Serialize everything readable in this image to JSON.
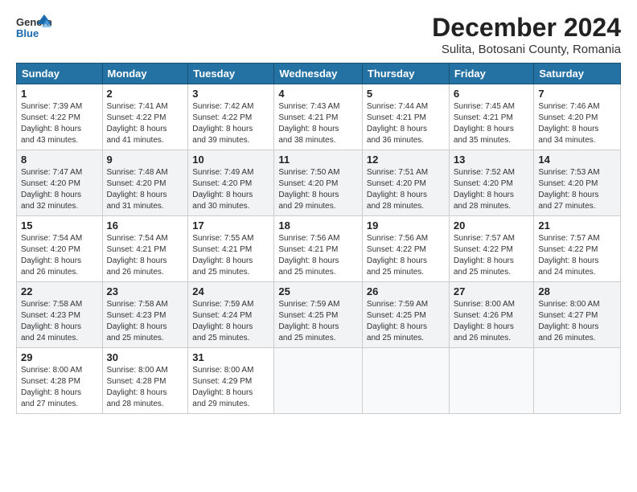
{
  "logo": {
    "line1": "General",
    "line2": "Blue"
  },
  "title": "December 2024",
  "subtitle": "Sulita, Botosani County, Romania",
  "header_days": [
    "Sunday",
    "Monday",
    "Tuesday",
    "Wednesday",
    "Thursday",
    "Friday",
    "Saturday"
  ],
  "weeks": [
    [
      {
        "day": "1",
        "detail": "Sunrise: 7:39 AM\nSunset: 4:22 PM\nDaylight: 8 hours\nand 43 minutes."
      },
      {
        "day": "2",
        "detail": "Sunrise: 7:41 AM\nSunset: 4:22 PM\nDaylight: 8 hours\nand 41 minutes."
      },
      {
        "day": "3",
        "detail": "Sunrise: 7:42 AM\nSunset: 4:22 PM\nDaylight: 8 hours\nand 39 minutes."
      },
      {
        "day": "4",
        "detail": "Sunrise: 7:43 AM\nSunset: 4:21 PM\nDaylight: 8 hours\nand 38 minutes."
      },
      {
        "day": "5",
        "detail": "Sunrise: 7:44 AM\nSunset: 4:21 PM\nDaylight: 8 hours\nand 36 minutes."
      },
      {
        "day": "6",
        "detail": "Sunrise: 7:45 AM\nSunset: 4:21 PM\nDaylight: 8 hours\nand 35 minutes."
      },
      {
        "day": "7",
        "detail": "Sunrise: 7:46 AM\nSunset: 4:20 PM\nDaylight: 8 hours\nand 34 minutes."
      }
    ],
    [
      {
        "day": "8",
        "detail": "Sunrise: 7:47 AM\nSunset: 4:20 PM\nDaylight: 8 hours\nand 32 minutes."
      },
      {
        "day": "9",
        "detail": "Sunrise: 7:48 AM\nSunset: 4:20 PM\nDaylight: 8 hours\nand 31 minutes."
      },
      {
        "day": "10",
        "detail": "Sunrise: 7:49 AM\nSunset: 4:20 PM\nDaylight: 8 hours\nand 30 minutes."
      },
      {
        "day": "11",
        "detail": "Sunrise: 7:50 AM\nSunset: 4:20 PM\nDaylight: 8 hours\nand 29 minutes."
      },
      {
        "day": "12",
        "detail": "Sunrise: 7:51 AM\nSunset: 4:20 PM\nDaylight: 8 hours\nand 28 minutes."
      },
      {
        "day": "13",
        "detail": "Sunrise: 7:52 AM\nSunset: 4:20 PM\nDaylight: 8 hours\nand 28 minutes."
      },
      {
        "day": "14",
        "detail": "Sunrise: 7:53 AM\nSunset: 4:20 PM\nDaylight: 8 hours\nand 27 minutes."
      }
    ],
    [
      {
        "day": "15",
        "detail": "Sunrise: 7:54 AM\nSunset: 4:20 PM\nDaylight: 8 hours\nand 26 minutes."
      },
      {
        "day": "16",
        "detail": "Sunrise: 7:54 AM\nSunset: 4:21 PM\nDaylight: 8 hours\nand 26 minutes."
      },
      {
        "day": "17",
        "detail": "Sunrise: 7:55 AM\nSunset: 4:21 PM\nDaylight: 8 hours\nand 25 minutes."
      },
      {
        "day": "18",
        "detail": "Sunrise: 7:56 AM\nSunset: 4:21 PM\nDaylight: 8 hours\nand 25 minutes."
      },
      {
        "day": "19",
        "detail": "Sunrise: 7:56 AM\nSunset: 4:22 PM\nDaylight: 8 hours\nand 25 minutes."
      },
      {
        "day": "20",
        "detail": "Sunrise: 7:57 AM\nSunset: 4:22 PM\nDaylight: 8 hours\nand 25 minutes."
      },
      {
        "day": "21",
        "detail": "Sunrise: 7:57 AM\nSunset: 4:22 PM\nDaylight: 8 hours\nand 24 minutes."
      }
    ],
    [
      {
        "day": "22",
        "detail": "Sunrise: 7:58 AM\nSunset: 4:23 PM\nDaylight: 8 hours\nand 24 minutes."
      },
      {
        "day": "23",
        "detail": "Sunrise: 7:58 AM\nSunset: 4:23 PM\nDaylight: 8 hours\nand 25 minutes."
      },
      {
        "day": "24",
        "detail": "Sunrise: 7:59 AM\nSunset: 4:24 PM\nDaylight: 8 hours\nand 25 minutes."
      },
      {
        "day": "25",
        "detail": "Sunrise: 7:59 AM\nSunset: 4:25 PM\nDaylight: 8 hours\nand 25 minutes."
      },
      {
        "day": "26",
        "detail": "Sunrise: 7:59 AM\nSunset: 4:25 PM\nDaylight: 8 hours\nand 25 minutes."
      },
      {
        "day": "27",
        "detail": "Sunrise: 8:00 AM\nSunset: 4:26 PM\nDaylight: 8 hours\nand 26 minutes."
      },
      {
        "day": "28",
        "detail": "Sunrise: 8:00 AM\nSunset: 4:27 PM\nDaylight: 8 hours\nand 26 minutes."
      }
    ],
    [
      {
        "day": "29",
        "detail": "Sunrise: 8:00 AM\nSunset: 4:28 PM\nDaylight: 8 hours\nand 27 minutes."
      },
      {
        "day": "30",
        "detail": "Sunrise: 8:00 AM\nSunset: 4:28 PM\nDaylight: 8 hours\nand 28 minutes."
      },
      {
        "day": "31",
        "detail": "Sunrise: 8:00 AM\nSunset: 4:29 PM\nDaylight: 8 hours\nand 29 minutes."
      },
      {
        "day": "",
        "detail": ""
      },
      {
        "day": "",
        "detail": ""
      },
      {
        "day": "",
        "detail": ""
      },
      {
        "day": "",
        "detail": ""
      }
    ]
  ]
}
